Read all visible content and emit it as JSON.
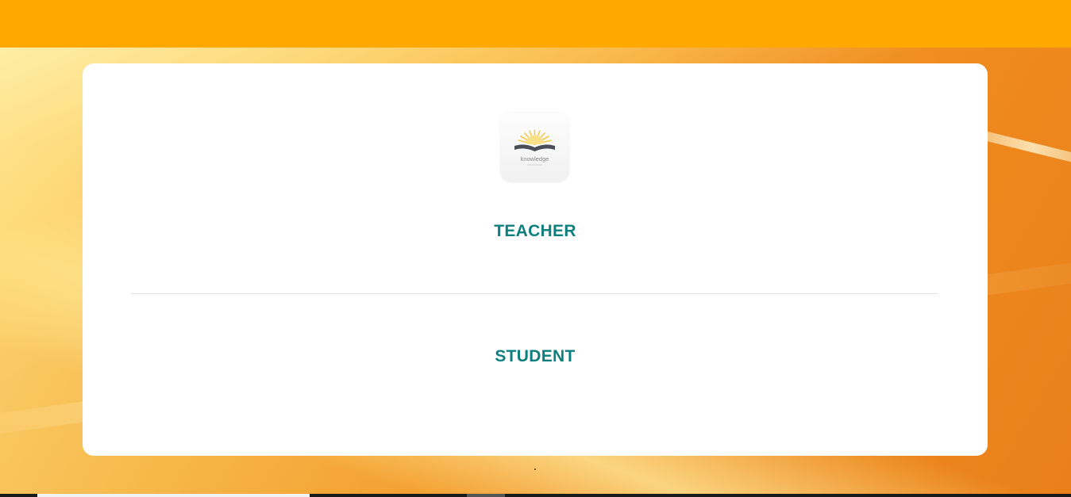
{
  "header": {
    "color": "#ffa800"
  },
  "logo": {
    "icon": "book-sunrise-logo-icon",
    "text": "knowledge"
  },
  "roles": {
    "teacher_label": "TEACHER",
    "student_label": "STUDENT"
  },
  "colors": {
    "role_text": "#0e7f7f",
    "card": "#ffffff",
    "background_accent": "#f39a2b"
  }
}
